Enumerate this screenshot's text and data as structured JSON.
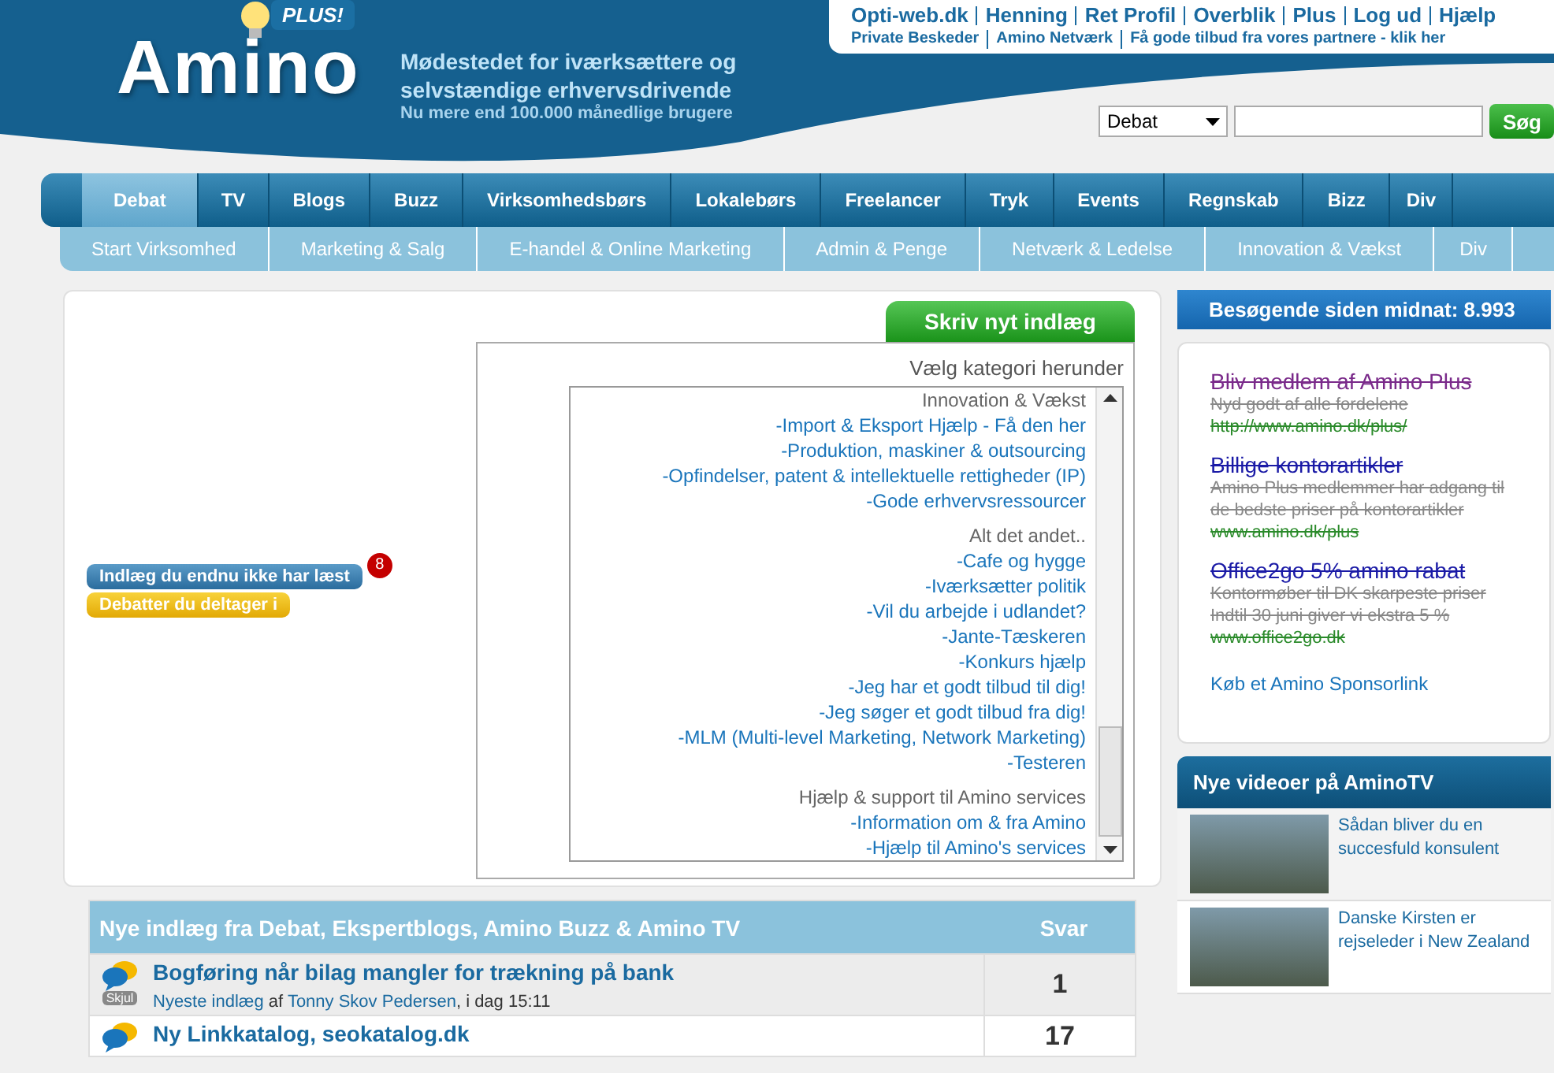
{
  "header": {
    "logo": "Amino",
    "logo_badge": "PLUS!",
    "tagline": "Mødestedet for iværksættere og selvstændige erhvervsdrivende",
    "subtagline": "Nu mere end 100.000 månedlige brugere",
    "user_links": [
      "Opti-web.dk",
      "Henning",
      "Ret Profil",
      "Overblik",
      "Plus",
      "Log ud",
      "Hjælp"
    ],
    "sub_links": [
      "Private Beskeder",
      "Amino Netværk",
      "Få gode tilbud fra vores partnere - klik her"
    ]
  },
  "search": {
    "scope": "Debat",
    "button": "Søg"
  },
  "nav_tabs": [
    {
      "label": "Debat",
      "selected": true
    },
    {
      "label": "TV",
      "selected": false
    },
    {
      "label": "Blogs",
      "selected": false
    },
    {
      "label": "Buzz",
      "selected": false
    },
    {
      "label": "Virksomhedsbørs",
      "selected": false
    },
    {
      "label": "Lokalebørs",
      "selected": false
    },
    {
      "label": "Freelancer",
      "selected": false
    },
    {
      "label": "Tryk",
      "selected": false
    },
    {
      "label": "Events",
      "selected": false
    },
    {
      "label": "Regnskab",
      "selected": false
    },
    {
      "label": "Bizz",
      "selected": false
    },
    {
      "label": "Div",
      "selected": false
    }
  ],
  "sub_nav": [
    "Start Virksomhed",
    "Marketing & Salg",
    "E-handel & Online Marketing",
    "Admin & Penge",
    "Netværk & Ledelse",
    "Innovation & Vækst",
    "Div"
  ],
  "new_post_button": "Skriv nyt indlæg",
  "category_picker": {
    "title": "Vælg kategori herunder",
    "groups": [
      {
        "heading": "Innovation & Vækst",
        "items": [
          "-Import & Eksport Hjælp - Få den her",
          "-Produktion, maskiner & outsourcing",
          "-Opfindelser, patent & intellektuelle rettigheder (IP)",
          "-Gode erhvervsressourcer"
        ]
      },
      {
        "heading": "Alt det andet..",
        "items": [
          "-Cafe og hygge",
          "-Iværksætter politik",
          "-Vil du arbejde i udlandet?",
          "-Jante-Tæskeren",
          "-Konkurs hjælp",
          "-Jeg har et godt tilbud til dig!",
          "-Jeg søger et godt tilbud fra dig!",
          "-MLM (Multi-level Marketing, Network Marketing)",
          "-Testeren"
        ]
      },
      {
        "heading": "Hjælp & support til Amino services",
        "items": [
          "-Information om & fra Amino",
          "-Hjælp til Amino's services"
        ]
      }
    ]
  },
  "side_buttons": [
    {
      "label": "Indlæg du endnu ikke har læst",
      "kind": "unread",
      "badge": "8"
    },
    {
      "label": "Debatter du deltager i",
      "kind": "participating"
    }
  ],
  "posts_table": {
    "columns": [
      "Nye indlæg fra Debat, Ekspertblogs, Amino Buzz & Amino TV",
      "Svar"
    ],
    "rows": [
      {
        "title": "Bogføring når bilag mangler for trækning på bank",
        "hide_label": "Skjul",
        "meta": "Nyeste indlæg",
        "by": "af",
        "author": "Tonny Skov Pedersen",
        "time": ", i dag 15:11",
        "replies": "1"
      },
      {
        "title": "Ny Linkkatalog, seokatalog.dk",
        "replies": "17"
      }
    ]
  },
  "visitors": "Besøgende siden midnat: 8.993",
  "sponsor_ads": [
    {
      "title": "Bliv medlem af Amino Plus",
      "visited": true,
      "lines": [
        "Nyd godt af alle fordelene"
      ],
      "url": "http://www.amino.dk/plus/"
    },
    {
      "title": "Billige kontorartikler",
      "visited": false,
      "lines": [
        "Amino Plus medlemmer har adgang til",
        "de bedste priser på kontorartikler"
      ],
      "url": "www.amino.dk/plus"
    },
    {
      "title": "Office2go 5% amino rabat",
      "visited": false,
      "lines": [
        "Kontormøber til DK skarpeste priser",
        "Indtil 30 juni giver vi ekstra 5 %"
      ],
      "url": "www.office2go.dk"
    }
  ],
  "sponsor_link": "Køb et Amino Sponsorlink",
  "videos": {
    "title": "Nye videoer på AminoTV",
    "items": [
      {
        "caption": "Sådan bliver du en succesfuld konsulent"
      },
      {
        "caption": "Danske Kirsten er rejseleder i New Zealand"
      }
    ]
  }
}
